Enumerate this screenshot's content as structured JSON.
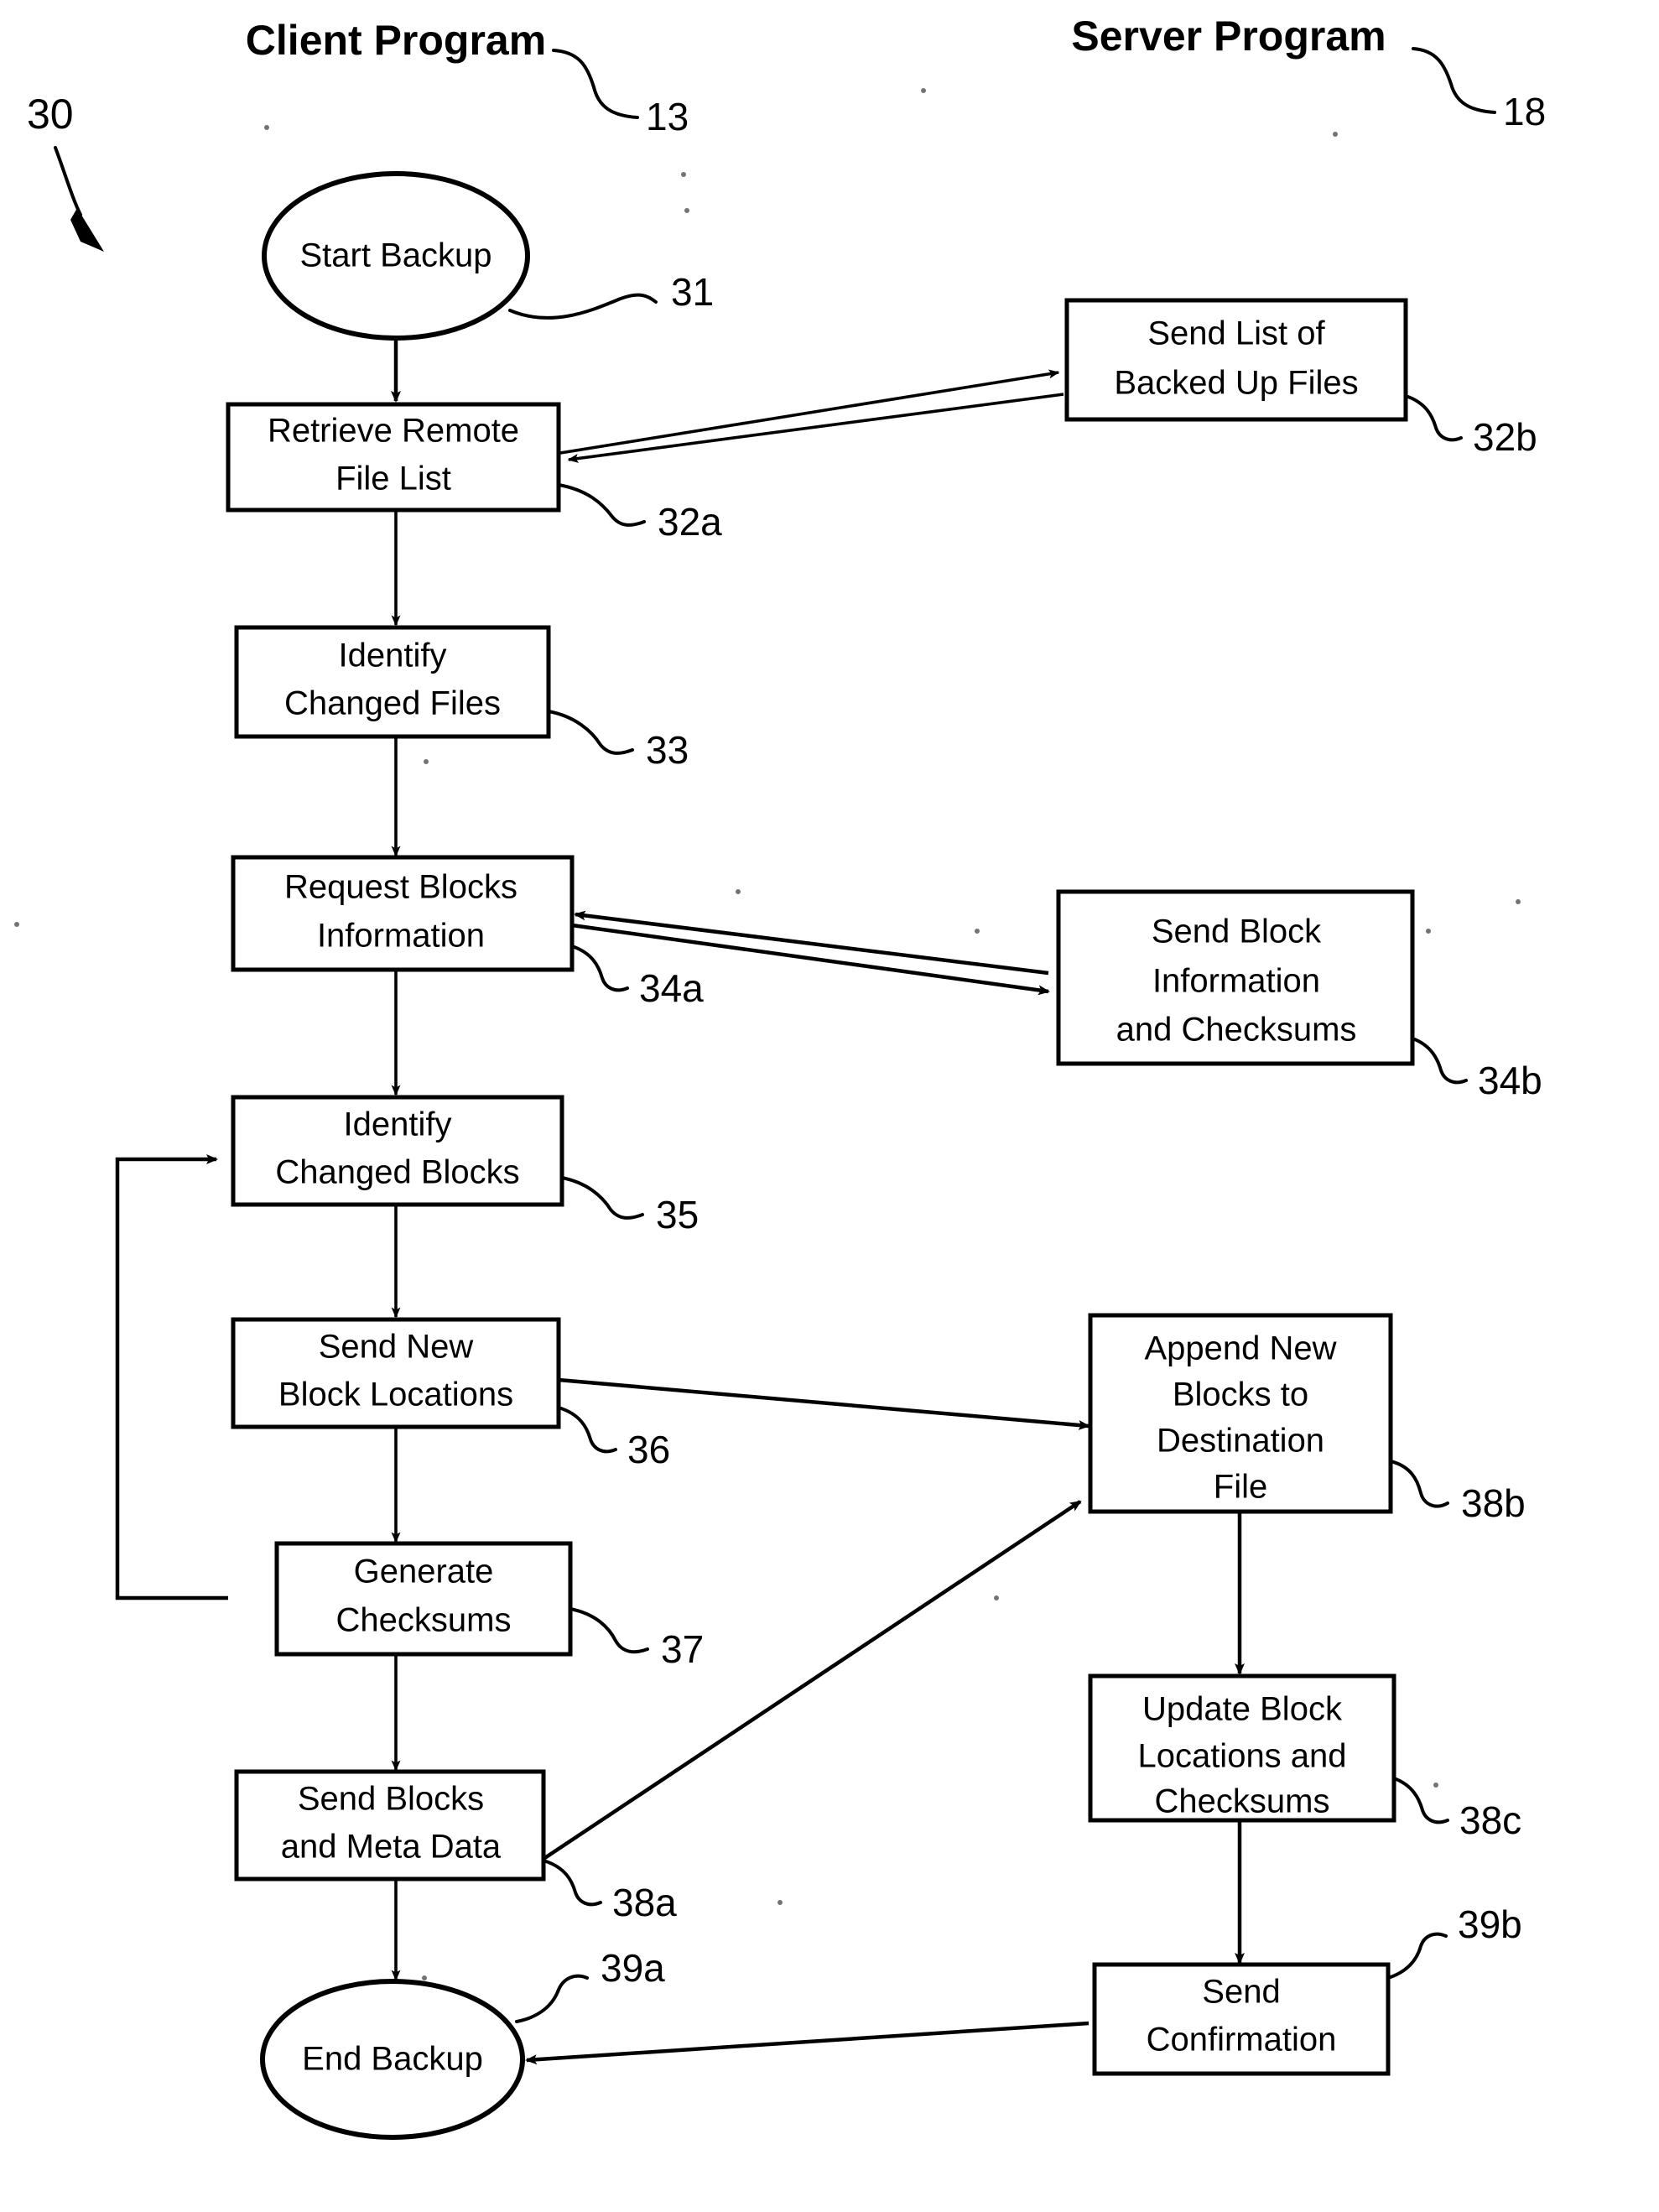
{
  "figure": {
    "figure_ref": "30",
    "columns": [
      {
        "id": "client",
        "title": "Client Program",
        "ref": "13"
      },
      {
        "id": "server",
        "title": "Server Program",
        "ref": "18"
      }
    ]
  },
  "nodes": {
    "start_backup": {
      "label": "Start Backup",
      "ref": "31",
      "shape": "ellipse",
      "column": "client"
    },
    "retrieve_list": {
      "label": "Retrieve Remote\nFile List",
      "ref": "32a",
      "shape": "box",
      "column": "client"
    },
    "send_list": {
      "label": "Send List of\nBacked Up Files",
      "ref": "32b",
      "shape": "box",
      "column": "server"
    },
    "identify_files": {
      "label": "Identify\nChanged Files",
      "ref": "33",
      "shape": "box",
      "column": "client"
    },
    "request_blocks": {
      "label": "Request Blocks\nInformation",
      "ref": "34a",
      "shape": "box",
      "column": "client"
    },
    "send_block_info": {
      "label": "Send Block\nInformation\nand Checksums",
      "ref": "34b",
      "shape": "box",
      "column": "server"
    },
    "identify_blocks": {
      "label": "Identify\nChanged Blocks",
      "ref": "35",
      "shape": "box",
      "column": "client"
    },
    "send_locations": {
      "label": "Send New\nBlock Locations",
      "ref": "36",
      "shape": "box",
      "column": "client"
    },
    "append_blocks": {
      "label": "Append New\nBlocks to\nDestination\nFile",
      "ref": "38b",
      "shape": "box",
      "column": "server"
    },
    "gen_checksums": {
      "label": "Generate\nChecksums",
      "ref": "37",
      "shape": "box",
      "column": "client"
    },
    "update_blocks": {
      "label": "Update Block\nLocations and\nChecksums",
      "ref": "38c",
      "shape": "box",
      "column": "server"
    },
    "send_blocks": {
      "label": "Send Blocks\nand Meta Data",
      "ref": "38a",
      "shape": "box",
      "column": "client"
    },
    "send_confirm": {
      "label": "Send\nConfirmation",
      "ref": "39b",
      "shape": "box",
      "column": "server"
    },
    "end_backup": {
      "label": "End Backup",
      "ref": "39a",
      "shape": "ellipse",
      "column": "client"
    }
  },
  "node_text": {
    "start_backup_l1": "Start Backup",
    "retrieve_list_l1": "Retrieve Remote",
    "retrieve_list_l2": "File List",
    "send_list_l1": "Send List of",
    "send_list_l2": "Backed Up Files",
    "identify_files_l1": "Identify",
    "identify_files_l2": "Changed Files",
    "request_blocks_l1": "Request Blocks",
    "request_blocks_l2": "Information",
    "send_block_info_l1": "Send Block",
    "send_block_info_l2": "Information",
    "send_block_info_l3": "and Checksums",
    "identify_blocks_l1": "Identify",
    "identify_blocks_l2": "Changed Blocks",
    "send_locations_l1": "Send New",
    "send_locations_l2": "Block Locations",
    "append_blocks_l1": "Append New",
    "append_blocks_l2": "Blocks to",
    "append_blocks_l3": "Destination",
    "append_blocks_l4": "File",
    "gen_checksums_l1": "Generate",
    "gen_checksums_l2": "Checksums",
    "update_blocks_l1": "Update Block",
    "update_blocks_l2": "Locations and",
    "update_blocks_l3": "Checksums",
    "send_blocks_l1": "Send Blocks",
    "send_blocks_l2": "and Meta Data",
    "send_confirm_l1": "Send",
    "send_confirm_l2": "Confirmation",
    "end_backup_l1": "End Backup"
  },
  "refs": {
    "fig": "30",
    "client_col": "13",
    "server_col": "18",
    "start_backup": "31",
    "retrieve_list": "32a",
    "send_list": "32b",
    "identify_files": "33",
    "request_blocks": "34a",
    "send_block_info": "34b",
    "identify_blocks": "35",
    "send_locations": "36",
    "append_blocks": "38b",
    "gen_checksums": "37",
    "update_blocks": "38c",
    "send_blocks": "38a",
    "send_confirm": "39b",
    "end_backup": "39a"
  },
  "titles": {
    "client": "Client Program",
    "server": "Server Program"
  },
  "flow": {
    "edges": [
      {
        "from": "start_backup",
        "to": "retrieve_list",
        "kind": "vertical"
      },
      {
        "from": "retrieve_list",
        "to": "send_list",
        "kind": "cross-right"
      },
      {
        "from": "send_list",
        "to": "retrieve_list",
        "kind": "cross-left"
      },
      {
        "from": "retrieve_list",
        "to": "identify_files",
        "kind": "vertical"
      },
      {
        "from": "identify_files",
        "to": "request_blocks",
        "kind": "vertical"
      },
      {
        "from": "request_blocks",
        "to": "send_block_info",
        "kind": "cross-right"
      },
      {
        "from": "send_block_info",
        "to": "request_blocks",
        "kind": "cross-left"
      },
      {
        "from": "request_blocks",
        "to": "identify_blocks",
        "kind": "vertical"
      },
      {
        "from": "identify_blocks",
        "to": "send_locations",
        "kind": "vertical"
      },
      {
        "from": "send_locations",
        "to": "append_blocks",
        "kind": "cross-right"
      },
      {
        "from": "send_locations",
        "to": "gen_checksums",
        "kind": "vertical"
      },
      {
        "from": "gen_checksums",
        "to": "identify_blocks",
        "kind": "feedback-loop-left"
      },
      {
        "from": "gen_checksums",
        "to": "send_blocks",
        "kind": "vertical"
      },
      {
        "from": "send_blocks",
        "to": "append_blocks",
        "kind": "cross-right-up"
      },
      {
        "from": "send_blocks",
        "to": "end_backup",
        "kind": "vertical"
      },
      {
        "from": "append_blocks",
        "to": "update_blocks",
        "kind": "vertical"
      },
      {
        "from": "update_blocks",
        "to": "send_confirm",
        "kind": "vertical"
      },
      {
        "from": "send_confirm",
        "to": "end_backup",
        "kind": "cross-left"
      }
    ]
  },
  "colors": {
    "ink": "#000000",
    "paper": "#ffffff"
  }
}
